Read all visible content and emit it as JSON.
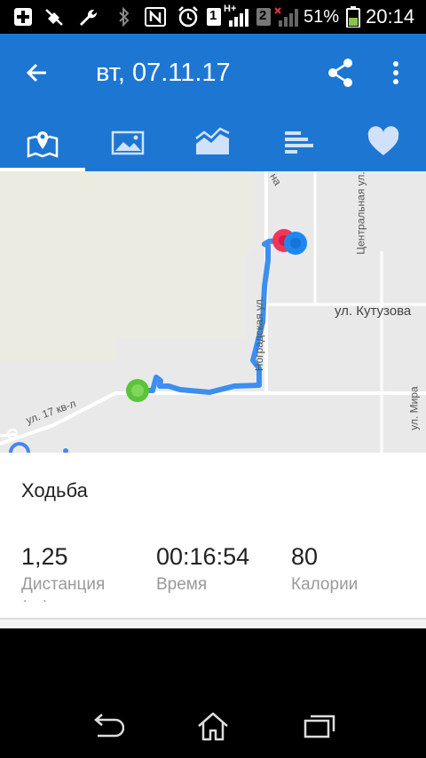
{
  "status_bar": {
    "battery_percent": "51%",
    "time": "20:14",
    "signal_label": "H+",
    "sim1": "1",
    "sim2": "2",
    "icons": [
      "add-icon",
      "silent-icon",
      "wrench-icon",
      "bluetooth-icon",
      "nfc-icon",
      "alarm-icon",
      "sim1-icon",
      "signal-icon",
      "sim2-icon",
      "no-signal-icon",
      "battery-icon"
    ]
  },
  "app_bar": {
    "title": "вт, 07.11.17",
    "color": "#1e76d3",
    "tabs": [
      {
        "name": "map",
        "icon": "map-icon",
        "selected": true
      },
      {
        "name": "photos",
        "icon": "image-icon",
        "selected": false
      },
      {
        "name": "graph",
        "icon": "chart-icon",
        "selected": false
      },
      {
        "name": "splits",
        "icon": "bars-icon",
        "selected": false
      },
      {
        "name": "heart",
        "icon": "heart-icon",
        "selected": false
      }
    ]
  },
  "map": {
    "streets": {
      "kutuzova": "ул. Кутузова",
      "nogradskaya": "Ноградская ул.",
      "tsentralnaya": "Центральная ул.",
      "mira": "ул. Мира",
      "kv17": "ул. 17 кв-л",
      "partial_top": "на"
    },
    "route_color": "#3d8ef0",
    "start_color": "#5cc33a",
    "end_colors": [
      "#f0365a",
      "#1e88f0"
    ]
  },
  "workout": {
    "activity": "Ходьба",
    "stats": [
      {
        "value": "1,25",
        "label": "Дистанция"
      },
      {
        "value": "00:16:54",
        "label": "Время"
      },
      {
        "value": "80",
        "label": "Калории"
      }
    ],
    "unit_partial": "(км)"
  }
}
